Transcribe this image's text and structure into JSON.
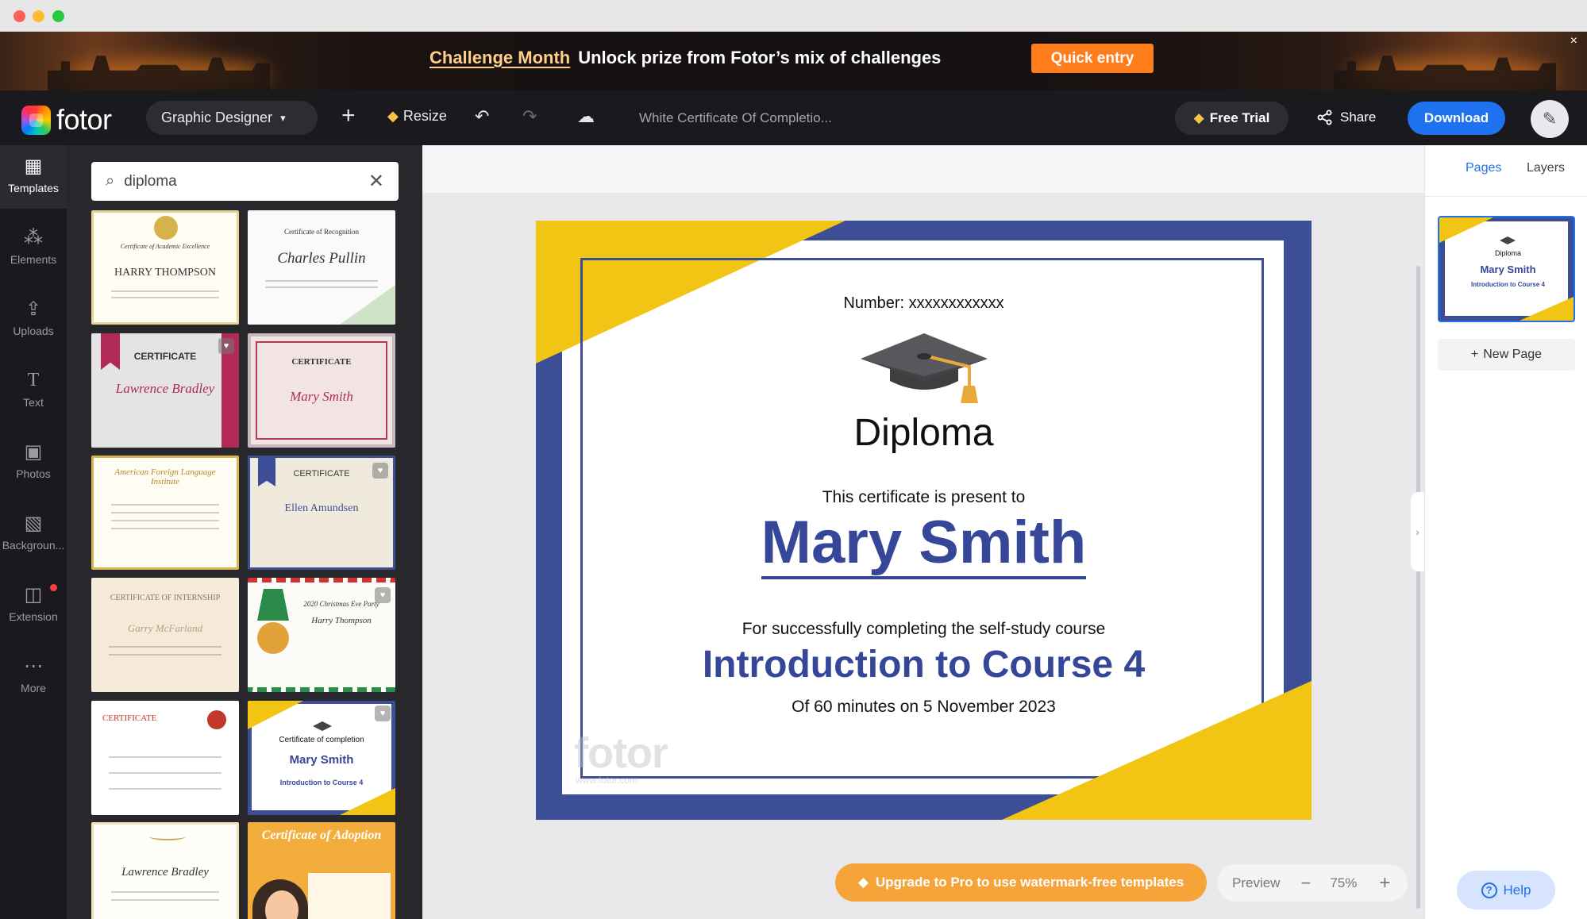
{
  "banner": {
    "highlight": "Challenge Month",
    "text": "Unlock prize from Fotor’s mix of challenges",
    "cta": "Quick entry",
    "close": "×"
  },
  "toolbar": {
    "logo": "fotor",
    "workspace": "Graphic Designer",
    "resize": "Resize",
    "doc_title": "White Certificate Of Completio...",
    "free_trial": "Free Trial",
    "share": "Share",
    "download": "Download"
  },
  "rail": [
    {
      "label": "Templates",
      "icon": "templates-icon"
    },
    {
      "label": "Elements",
      "icon": "elements-icon"
    },
    {
      "label": "Uploads",
      "icon": "upload-icon"
    },
    {
      "label": "Text",
      "icon": "text-icon"
    },
    {
      "label": "Photos",
      "icon": "photos-icon"
    },
    {
      "label": "Backgroun...",
      "icon": "background-icon"
    },
    {
      "label": "Extension",
      "icon": "extension-icon"
    },
    {
      "label": "More",
      "icon": "more-icon"
    }
  ],
  "search": {
    "value": "diploma"
  },
  "templates": [
    {
      "title": "Certificate of Academic Excellence",
      "name": "HARRY THOMPSON"
    },
    {
      "title": "Certificate of Recognition",
      "name": "Charles Pullin"
    },
    {
      "title": "CERTIFICATE",
      "name": "Lawrence Bradley"
    },
    {
      "title": "CERTIFICATE",
      "name": "Mary Smith"
    },
    {
      "title": "American Foreign Language Institute",
      "name": ""
    },
    {
      "title": "CERTIFICATE",
      "name": "Ellen Amundsen"
    },
    {
      "title": "CERTIFICATE OF INTERNSHIP",
      "name": "Garry McFarland"
    },
    {
      "title": "2020 Christmas Eve Party",
      "name": "Harry Thompson"
    },
    {
      "title": "CERTIFICATE",
      "name": ""
    },
    {
      "title": "Certificate of completion",
      "name": "Mary Smith",
      "sub": "Introduction to Course 4"
    },
    {
      "title": "",
      "name": "Lawrence Bradley"
    },
    {
      "title": "Certificate of Adoption",
      "name": ""
    }
  ],
  "certificate": {
    "number": "Number: xxxxxxxxxxxx",
    "title": "Diploma",
    "present": "This certificate is present to",
    "name": "Mary Smith",
    "for": "For successfully completing the self-study course",
    "course": "Introduction to Course 4",
    "date": "Of 60 minutes on 5 November 2023",
    "watermark": "fotor",
    "watermark_url": "www.fotor.com"
  },
  "bottom": {
    "upgrade": "Upgrade to Pro to use watermark-free templates",
    "preview": "Preview",
    "zoom": "75%"
  },
  "right_panel": {
    "tab_pages": "Pages",
    "tab_layers": "Layers",
    "thumb_title": "Diploma",
    "thumb_name": "Mary Smith",
    "thumb_course": "Introduction to Course 4",
    "new_page": "New Page",
    "help": "Help"
  },
  "colors": {
    "accent": "#1f72ef",
    "cert_blue": "#3c4e96",
    "cert_yellow": "#f2c514",
    "upgrade_orange": "#f6a33a",
    "banner_cta": "#ff7e1b"
  }
}
